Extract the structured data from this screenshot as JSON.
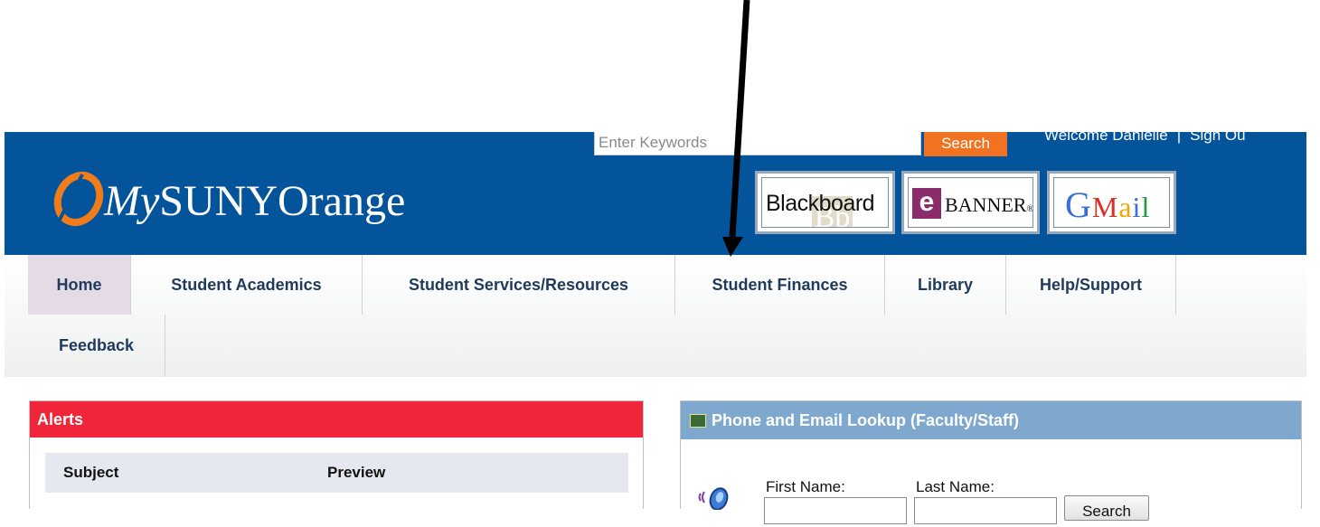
{
  "header": {
    "logo_my": "My",
    "logo_rest": "SUNYOrange",
    "search_placeholder": "Enter Keywords",
    "search_button": "Search",
    "welcome": "Welcome Danielle",
    "separator": "|",
    "sign_out": "Sign Ou",
    "brand_color": "#03549b",
    "accent_color": "#f17220"
  },
  "app_links": {
    "blackboard": "Blackboard",
    "blackboard_watermark": "Bb",
    "banner_e": "e",
    "banner": "BANNER",
    "banner_mark": "®",
    "gmail": [
      "G",
      "M",
      "a",
      "i",
      "l"
    ]
  },
  "nav": {
    "items": [
      {
        "label": "Home",
        "active": true
      },
      {
        "label": "Student Academics"
      },
      {
        "label": "Student Services/Resources"
      },
      {
        "label": "Student Finances"
      },
      {
        "label": "Library"
      },
      {
        "label": "Help/Support"
      },
      {
        "label": "Feedback"
      }
    ]
  },
  "alerts": {
    "title": "Alerts",
    "columns": [
      "Subject",
      "Preview"
    ],
    "header_color": "#f0253a"
  },
  "lookup": {
    "title": "Phone and Email Lookup (Faculty/Staff)",
    "first_name_label": "First Name:",
    "last_name_label": "Last Name:",
    "search_button": "Search",
    "header_color": "#7ea8cd"
  }
}
